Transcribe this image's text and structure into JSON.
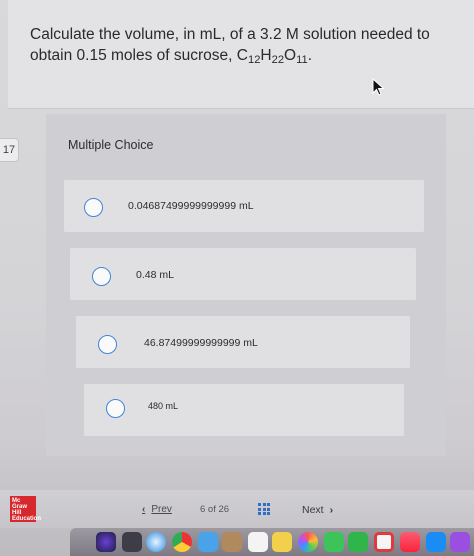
{
  "question": {
    "text_before": "Calculate the volume, in mL, of a 3.2 M solution needed to obtain 0.15 moles of sucrose, C",
    "sub_12": "12",
    "h": "H",
    "sub_22": "22",
    "o": "O",
    "sub_11": "11",
    "end": "."
  },
  "question_number": "17",
  "multiple_choice": {
    "header": "Multiple Choice",
    "options": [
      {
        "label": "0.04687499999999999 mL"
      },
      {
        "label": "0.48 mL"
      },
      {
        "label": "46.87499999999999 mL"
      },
      {
        "label": "480 mL"
      }
    ]
  },
  "footer": {
    "logo_text": "Mc Graw Hill Education",
    "prev_label": "Prev",
    "page_text": "6 of 26",
    "next_label": "Next"
  },
  "colors": {
    "radio_border": "#3f86d8",
    "logo_red": "#d6282d",
    "grid_blue": "#2f6fc4"
  },
  "icons": {
    "cursor": "cursor-arrow-icon",
    "grid": "grid-icon",
    "prev": "chevron-left-icon",
    "next": "chevron-right-icon"
  }
}
